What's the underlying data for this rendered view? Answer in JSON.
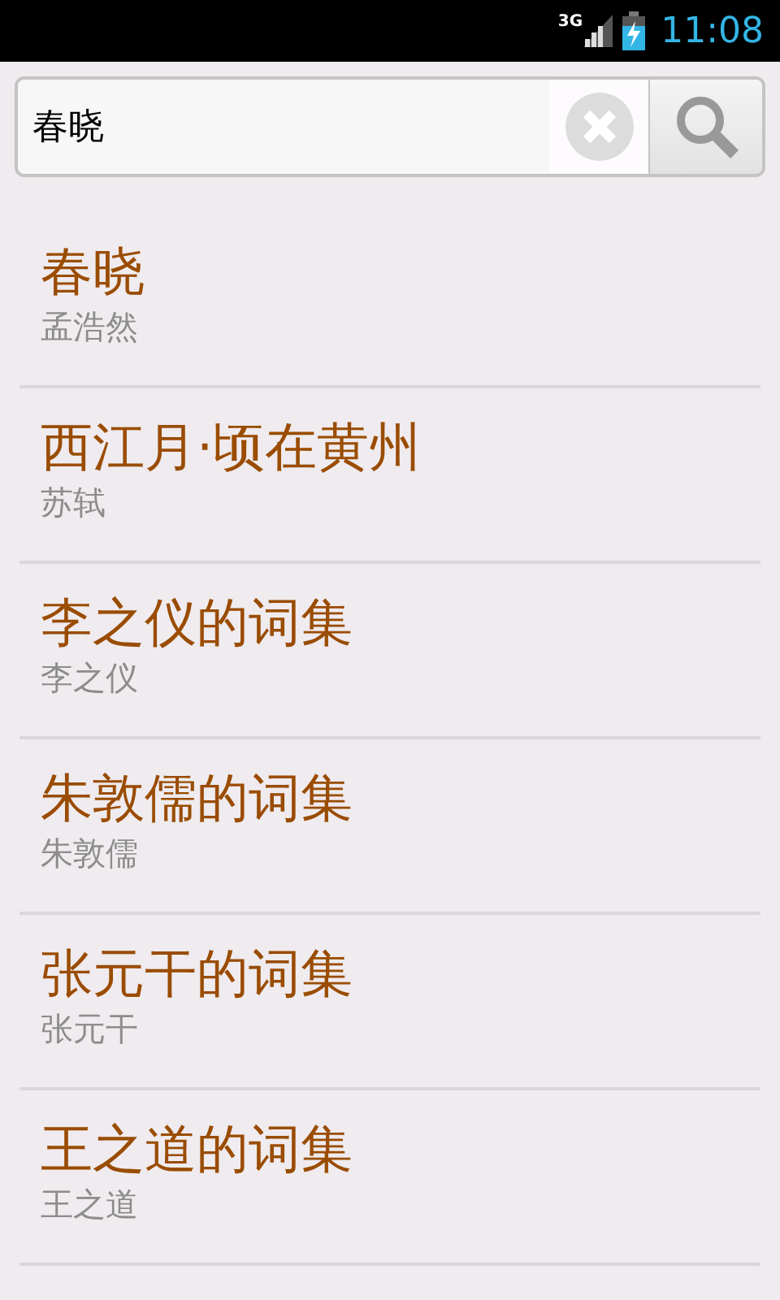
{
  "status_bar": {
    "network": "3G",
    "time": "11:08"
  },
  "search": {
    "value": "春晓"
  },
  "results": [
    {
      "title": "春晓",
      "author": "孟浩然"
    },
    {
      "title": "西江月·顷在黄州",
      "author": "苏轼"
    },
    {
      "title": "李之仪的词集",
      "author": "李之仪"
    },
    {
      "title": "朱敦儒的词集",
      "author": "朱敦儒"
    },
    {
      "title": "张元干的词集",
      "author": "张元干"
    },
    {
      "title": "王之道的词集",
      "author": "王之道"
    }
  ]
}
